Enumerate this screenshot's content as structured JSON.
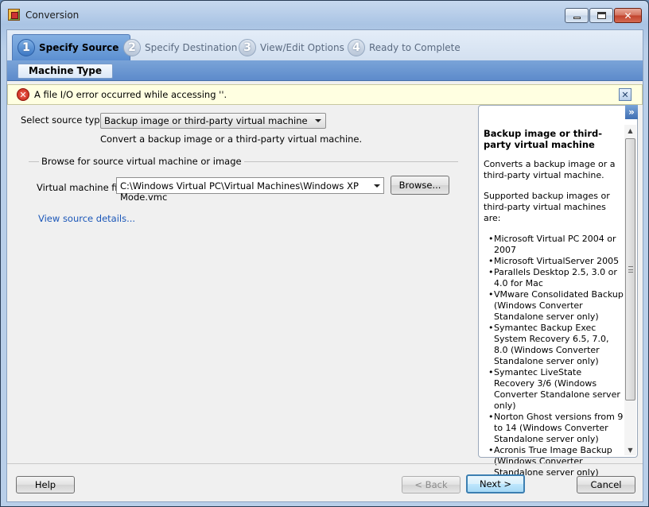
{
  "window": {
    "title": "Conversion"
  },
  "steps": [
    {
      "num": "1",
      "label": "Specify Source"
    },
    {
      "num": "2",
      "label": "Specify Destination"
    },
    {
      "num": "3",
      "label": "View/Edit Options"
    },
    {
      "num": "4",
      "label": "Ready to Complete"
    }
  ],
  "subtab": {
    "label": "Machine Type"
  },
  "error": {
    "message": "A file I/O error occurred while accessing ''."
  },
  "source": {
    "select_label": "Select source type:",
    "select_value": "Backup image or third-party virtual machine",
    "description": "Convert a backup image or a third-party virtual machine.",
    "group_label": "Browse for source virtual machine or image",
    "vm_file_label": "Virtual machine file:",
    "vm_file_value": "C:\\Windows Virtual PC\\Virtual Machines\\Windows XP Mode.vmc",
    "browse_label": "Browse...",
    "details_link": "View source details..."
  },
  "sidepanel": {
    "toggle": "»",
    "title": "Backup image or third-party virtual machine",
    "p1": "Converts a backup image or a third-party virtual machine.",
    "p2": "Supported backup images or third-party virtual machines are:",
    "items": [
      "Microsoft Virtual PC 2004 or 2007",
      "Microsoft VirtualServer 2005",
      "Parallels Desktop 2.5, 3.0 or 4.0 for Mac",
      "VMware Consolidated Backup (Windows Converter Standalone server only)",
      "Symantec Backup Exec System Recovery 6.5, 7.0, 8.0 (Windows Converter Standalone server only)",
      "Symantec LiveState Recovery 3/6 (Windows Converter Standalone server only)",
      "Norton Ghost versions from 9 to 14 (Windows Converter Standalone server only)",
      "Acronis True Image Backup (Windows Converter Standalone server only)"
    ]
  },
  "footer": {
    "help": "Help",
    "back": "< Back",
    "next": "Next >",
    "cancel": "Cancel"
  }
}
